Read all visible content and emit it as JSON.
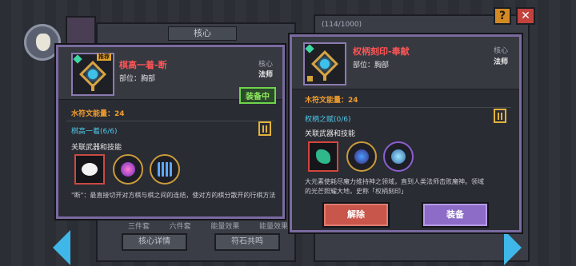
{
  "background": {
    "core_tab": "核心",
    "counter": "(114/1000)",
    "labels": [
      "三件套",
      "六件套",
      "能量效果",
      "能量效果"
    ],
    "left_buttons": [
      "核心详情",
      "符石共鸣"
    ]
  },
  "controls": {
    "help": "?",
    "close": "✕"
  },
  "left_card": {
    "badge": "推荐",
    "title": "棋高一着-断",
    "slot": "部位：胸部",
    "type_label": "核心",
    "class_label": "法师",
    "status": "装备中",
    "energy": "水符文能量：24",
    "set_name": "棋高一着(6/6)",
    "linked_label": "关联武器和技能",
    "description": "\"断\"：最直接切开对方棋与棋之间的连结，使对方的棋分散开的行棋方法",
    "icons": [
      "black-white-stone-icon",
      "galaxy-orb-icon",
      "grid-orb-icon"
    ],
    "colors": {
      "title": "#ff5555",
      "energy": "#f29e2e",
      "set": "#4fc7e8",
      "equipped": "#8fe85f"
    }
  },
  "right_card": {
    "title": "权柄刻印-奉献",
    "slot": "部位：胸部",
    "type_label": "核心",
    "class_label": "法师",
    "energy": "木符文能量：24",
    "set_name": "权柄之赋(0/6)",
    "linked_label": "关联武器和技能",
    "description_lines": [
      "大元素使耗尽魔力维持神之领域，直到人类法师击败魔神。领域",
      "的光芒照耀大地，史称「权柄刻印」"
    ],
    "icons": [
      "green-dragon-icon",
      "rune-triangle-orb-icon",
      "cyan-wing-orb-icon"
    ],
    "buttons": {
      "unequip": "解除",
      "equip": "装备"
    }
  }
}
